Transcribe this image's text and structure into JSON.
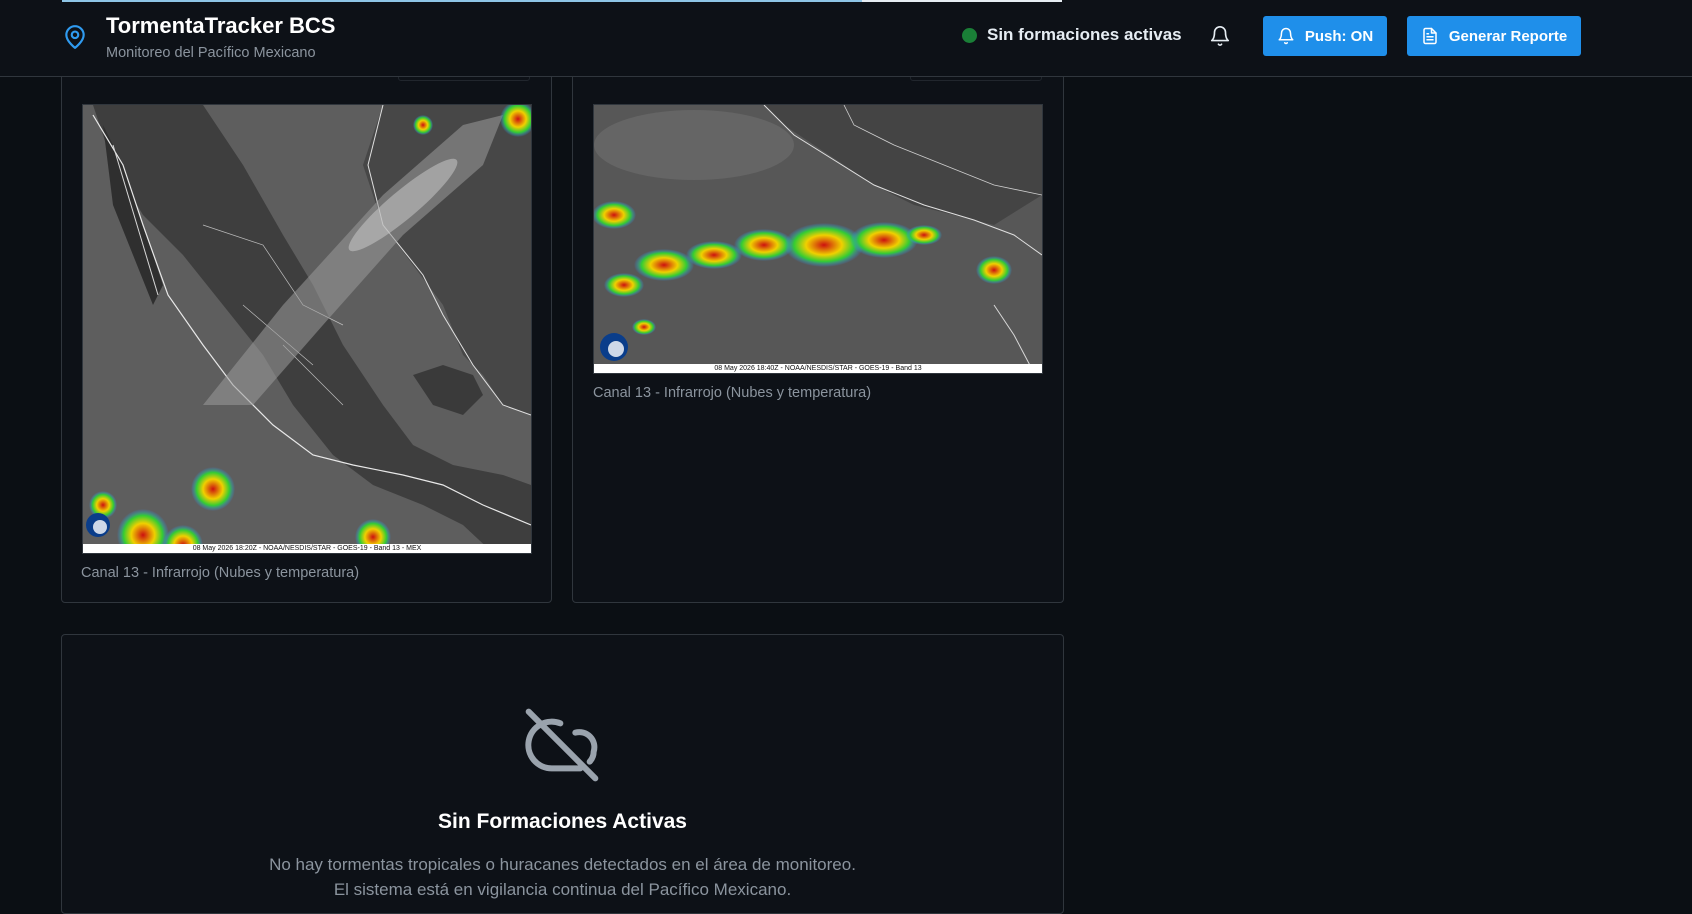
{
  "header": {
    "progress": 0.8,
    "title": "TormentaTracker BCS",
    "subtitle": "Monitoreo del Pacífico Mexicano",
    "status_text": "Sin formaciones activas",
    "status_color": "#1a7f37",
    "push_label": "Push: ON",
    "report_label": "Generar Reporte",
    "accent_color": "#1f8fea"
  },
  "panels": [
    {
      "image_stamp": "08 May 2026 18:20Z - NOAA/NESDIS/STAR - GOES-19 - Band 13 - MEX",
      "caption": "Canal 13 - Infrarrojo (Nubes y temperatura)"
    },
    {
      "image_stamp": "08 May 2026 18:40Z - NOAA/NESDIS/STAR - GOES-19 - Band 13",
      "caption": "Canal 13 - Infrarrojo (Nubes y temperatura)"
    }
  ],
  "empty_state": {
    "icon": "cloud-off-icon",
    "title": "Sin Formaciones Activas",
    "description": "No hay tormentas tropicales o huracanes detectados en el área de monitoreo. El sistema está en vigilancia continua del Pacífico Mexicano."
  }
}
